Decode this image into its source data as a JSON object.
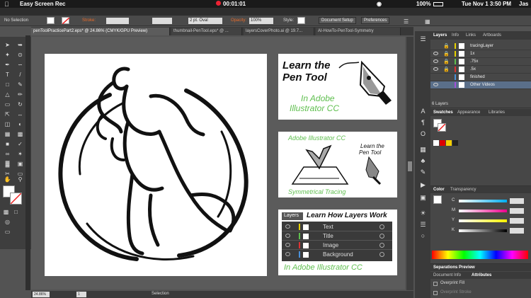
{
  "menubar": {
    "app": "Easy Screen Rec",
    "timer": "00:01:01",
    "battery": "100%",
    "clock": "Tue Nov 1  3:50 PM",
    "user": "Jas"
  },
  "controlbar": {
    "selection": "No Selection",
    "stroke_label": "Stroke:",
    "brush": "2 pt. Oval",
    "opacity_label": "Opacity:",
    "opacity": "100%",
    "style_label": "Style:",
    "doc_setup": "Document Setup",
    "preferences": "Preferences"
  },
  "tabs": [
    {
      "label": "penToolPracticePart2.eps* @ 24.86% (CMYK/GPU Preview)"
    },
    {
      "label": "thumbnail-PenTool.eps* @ ..."
    },
    {
      "label": "layersCoverPhoto.ai @ 19.7..."
    },
    {
      "label": "AI-HowTo-PenTool-Symmetry"
    }
  ],
  "cards": {
    "pen": {
      "line1": "Learn the",
      "line2": "Pen Tool",
      "sub1": "In Adobe",
      "sub2": "Illustrator CC"
    },
    "sym": {
      "top": "Adobe Illustrator CC",
      "pen1": "Learn the",
      "pen2": "Pen Tool",
      "bottom": "Symmetrical Tracing"
    },
    "layers": {
      "tab": "Layers",
      "title": "Learn How Layers Work",
      "rows": [
        "Text",
        "Title",
        "Image",
        "Background"
      ],
      "bottom": "In Adobe Illustrator CC"
    }
  },
  "status": {
    "zoom": "24.86%",
    "page": "1",
    "mode": "Selection"
  },
  "layers_panel": {
    "tabs": [
      "Layers",
      "Info",
      "Links",
      "Artboards"
    ],
    "rows": [
      {
        "name": "tracingLayer"
      },
      {
        "name": "1x"
      },
      {
        "name": ".75x"
      },
      {
        "name": ".5x"
      },
      {
        "name": "finished"
      },
      {
        "name": "Other Videos"
      }
    ],
    "count": "6 Layers"
  },
  "swatches_panel": {
    "tabs": [
      "Swatches",
      "Appearance",
      "Libraries"
    ]
  },
  "color_panel": {
    "tabs": [
      "Color",
      "Transparency"
    ],
    "channels": [
      {
        "label": "C",
        "value": ""
      },
      {
        "label": "M",
        "value": ""
      },
      {
        "label": "Y",
        "value": ""
      },
      {
        "label": "K",
        "value": ""
      }
    ]
  },
  "sep_panel": {
    "title": "Separations Preview"
  },
  "doc_panel": {
    "tabs": [
      "Document Info",
      "Attributes"
    ],
    "overprint_fill": "Overprint Fill",
    "overprint_stroke": "Overprint Stroke"
  },
  "colors": {
    "accent": "#4a90d9",
    "cmyk_c": "#00aeef",
    "cmyk_m": "#ec008c",
    "cmyk_y": "#fff200",
    "green_text": "#5fbf4f"
  }
}
